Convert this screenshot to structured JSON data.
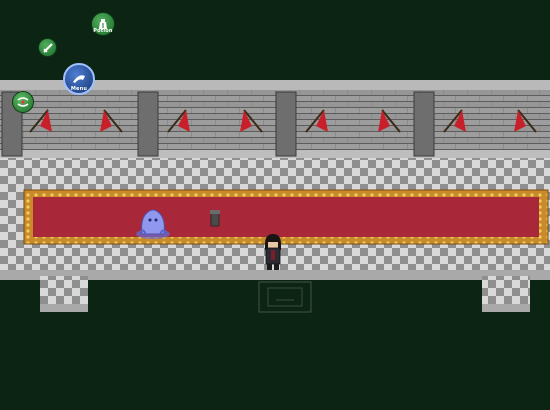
{
  "hud": {
    "potion_label": "Potion",
    "sword_label": "",
    "menu_label": "Menu",
    "wind_label": ""
  },
  "colors": {
    "background": "#0b2413",
    "wall_stone": "#8a8a8a",
    "wall_dark": "#4a4a4a",
    "floor_light": "#d6d6d6",
    "floor_dark": "#8e8e8e",
    "carpet": "#a8283a",
    "carpet_border": "#d9a63a",
    "banner": "#c8202a"
  },
  "icons": [
    "potion-icon",
    "sword-icon",
    "menu-icon",
    "wind-icon"
  ]
}
